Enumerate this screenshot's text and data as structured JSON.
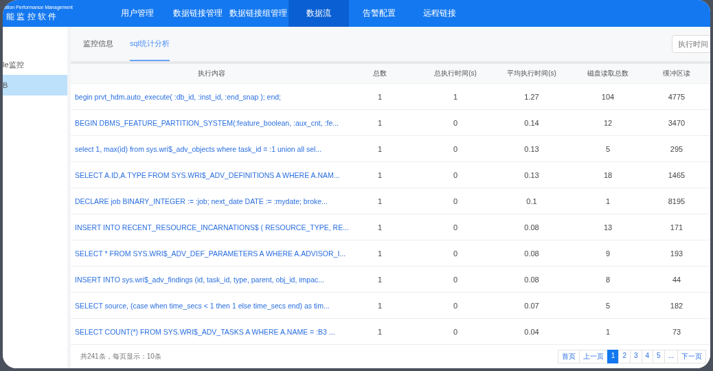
{
  "logo": {
    "subtitle": "ation Performance Management",
    "title": "能 监 控 软 件"
  },
  "nav": [
    {
      "label": "用户管理",
      "selected": false
    },
    {
      "label": "数据链接管理",
      "selected": false
    },
    {
      "label": "数据链接组管理",
      "selected": false
    },
    {
      "label": "数据流",
      "selected": true
    },
    {
      "label": "告警配置",
      "selected": false
    },
    {
      "label": "远程链接",
      "selected": false
    }
  ],
  "sidebar": {
    "items": [
      {
        "label": "le监控",
        "selected": false
      },
      {
        "label": "B",
        "selected": true
      }
    ]
  },
  "tabs": [
    {
      "label": "监控信息",
      "selected": false
    },
    {
      "label": "sql统计分析",
      "selected": true
    }
  ],
  "filter": {
    "placeholder": "执行时间"
  },
  "table": {
    "columns": [
      "执行内容",
      "总数",
      "总执行时间(s)",
      "平均执行时间(s)",
      "磁盘读取总数",
      "缓冲区读"
    ],
    "rows": [
      [
        "begin prvt_hdm.auto_execute( :db_id, :inst_id, :end_snap ); end;",
        "1",
        "1",
        "1.27",
        "104",
        "4775"
      ],
      [
        "BEGIN DBMS_FEATURE_PARTITION_SYSTEM(:feature_boolean, :aux_cnt, :fe...",
        "1",
        "0",
        "0.14",
        "12",
        "3470"
      ],
      [
        "select 1, max(id) from sys.wri$_adv_objects where task_id = :1 union all sel...",
        "1",
        "0",
        "0.13",
        "5",
        "295"
      ],
      [
        "SELECT A.ID,A.TYPE FROM SYS.WRI$_ADV_DEFINITIONS A WHERE A.NAM...",
        "1",
        "0",
        "0.13",
        "18",
        "1465"
      ],
      [
        "DECLARE job BINARY_INTEGER := :job; next_date DATE := :mydate; broke...",
        "1",
        "0",
        "0.1",
        "1",
        "8195"
      ],
      [
        "INSERT INTO RECENT_RESOURCE_INCARNATIONS$ ( RESOURCE_TYPE, RE...",
        "1",
        "0",
        "0.08",
        "13",
        "171"
      ],
      [
        "SELECT * FROM SYS.WRI$_ADV_DEF_PARAMETERS A WHERE A.ADVISOR_I...",
        "1",
        "0",
        "0.08",
        "9",
        "193"
      ],
      [
        "INSERT INTO sys.wri$_adv_findings (id, task_id, type, parent, obj_id, impac...",
        "1",
        "0",
        "0.08",
        "8",
        "44"
      ],
      [
        "SELECT source, (case when time_secs < 1 then 1 else time_secs end) as tim...",
        "1",
        "0",
        "0.07",
        "5",
        "182"
      ],
      [
        "SELECT COUNT(*) FROM SYS.WRI$_ADV_TASKS A WHERE A.NAME = :B3 ...",
        "1",
        "0",
        "0.04",
        "1",
        "73"
      ]
    ]
  },
  "footer": {
    "summary": "共241条，每页显示：10条",
    "pages": [
      {
        "label": "首页",
        "selected": false
      },
      {
        "label": "上一页",
        "selected": false
      },
      {
        "label": "1",
        "selected": true
      },
      {
        "label": "2",
        "selected": false
      },
      {
        "label": "3",
        "selected": false
      },
      {
        "label": "4",
        "selected": false
      },
      {
        "label": "5",
        "selected": false
      },
      {
        "label": "...",
        "selected": false
      },
      {
        "label": "下一页",
        "selected": false
      }
    ]
  }
}
